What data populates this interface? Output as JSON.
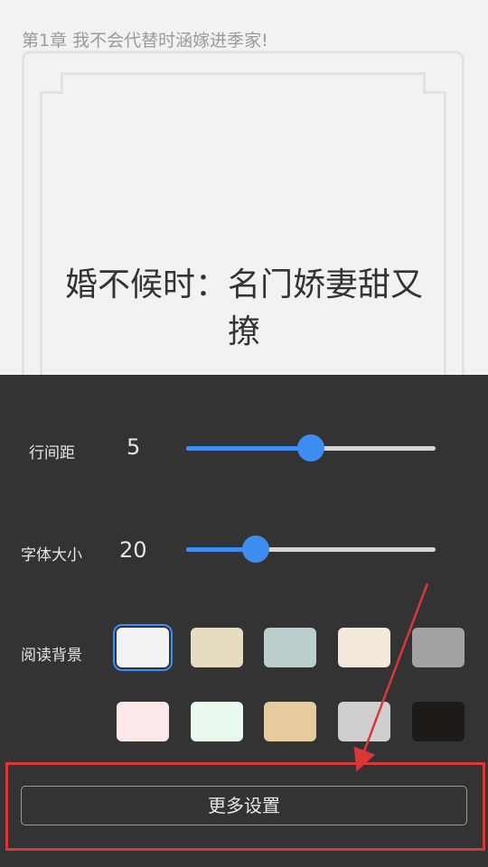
{
  "chapter": {
    "title": "第1章 我不会代替时涵嫁进季家!"
  },
  "cover": {
    "title": "婚不候时：名门娇妻甜又撩"
  },
  "settings": {
    "line_spacing": {
      "label": "行间距",
      "value": "5",
      "level_percent": 50
    },
    "font_size": {
      "label": "字体大小",
      "value": "20",
      "level_percent": 28
    },
    "background": {
      "label": "阅读背景",
      "swatches": [
        {
          "color": "#f2f2f2",
          "selected": true
        },
        {
          "color": "#e6dcc0",
          "selected": false
        },
        {
          "color": "#bccfcf",
          "selected": false
        },
        {
          "color": "#f2e9dc",
          "selected": false
        },
        {
          "color": "#a3a3a3",
          "selected": false
        },
        {
          "color": "#fce8e8",
          "selected": false
        },
        {
          "color": "#e9f9ee",
          "selected": false
        },
        {
          "color": "#e5cb9e",
          "selected": false
        },
        {
          "color": "#cfcfcf",
          "selected": false
        },
        {
          "color": "#1e1a18",
          "selected": false
        }
      ]
    },
    "more_button": {
      "label": "更多设置"
    }
  },
  "colors": {
    "accent": "#3d8ef0",
    "annotation": "#d9383a",
    "panel_bg": "#333333"
  }
}
